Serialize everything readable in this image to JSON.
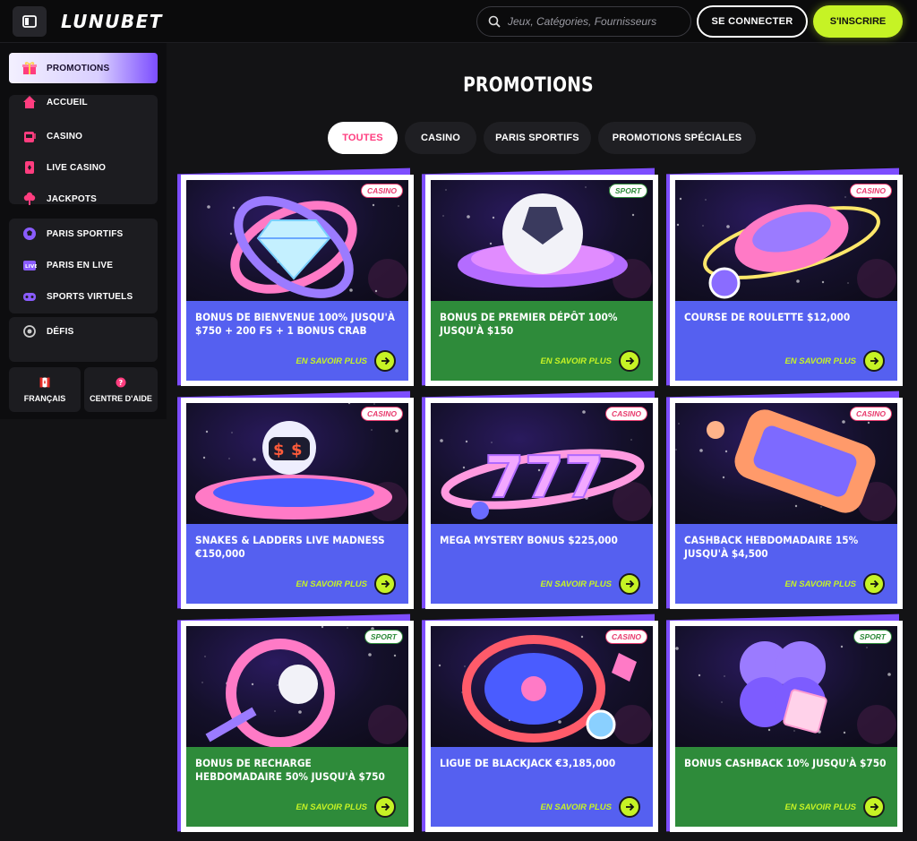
{
  "header": {
    "logo": "LUNUBET",
    "search_placeholder": "Jeux, Catégories, Fournisseurs",
    "login_label": "SE CONNECTER",
    "signup_label": "S'INSCRIRE"
  },
  "sidebar": {
    "promotions": "PROMOTIONS",
    "group1": [
      "ACCUEIL",
      "CASINO",
      "LIVE CASINO",
      "JACKPOTS"
    ],
    "group2": [
      "PARIS SPORTIFS",
      "PARIS EN LIVE",
      "SPORTS VIRTUELS"
    ],
    "group3": [
      "DÉFIS"
    ],
    "language": "FRANÇAIS",
    "help": "CENTRE D'AIDE"
  },
  "main": {
    "title": "PROMOTIONS",
    "tabs": [
      "TOUTES",
      "CASINO",
      "PARIS SPORTIFS",
      "PROMOTIONS SPÉCIALES"
    ],
    "more_label": "EN SAVOIR PLUS",
    "cards": [
      {
        "title": "BONUS DE BIENVENUE 100% JUSQU'À $750 + 200 FS + 1 BONUS CRAB",
        "badge": "CASINO",
        "color": "blue",
        "art": "diamond"
      },
      {
        "title": "BONUS DE PREMIER DÉPÔT 100% JUSQU'À $150",
        "badge": "SPORT",
        "color": "green",
        "art": "football"
      },
      {
        "title": "COURSE DE ROULETTE $12,000",
        "badge": "CASINO",
        "color": "blue",
        "art": "roulette"
      },
      {
        "title": "SNAKES & LADDERS LIVE MADNESS €150,000",
        "badge": "CASINO",
        "color": "blue",
        "art": "robot"
      },
      {
        "title": "MEGA MYSTERY BONUS $225,000",
        "badge": "CASINO",
        "color": "blue",
        "art": "sevens"
      },
      {
        "title": "CASHBACK HEBDOMADAIRE 15% JUSQU'À $4,500",
        "badge": "CASINO",
        "color": "blue",
        "art": "slot"
      },
      {
        "title": "BONUS DE RECHARGE HEBDOMADAIRE 50% JUSQU'À $750",
        "badge": "SPORT",
        "color": "green",
        "art": "tennis"
      },
      {
        "title": "LIGUE DE BLACKJACK €3,185,000",
        "badge": "CASINO",
        "color": "blue",
        "art": "chips"
      },
      {
        "title": "BONUS CASHBACK 10% JUSQU'À $750",
        "badge": "SPORT",
        "color": "green",
        "art": "gift"
      }
    ]
  }
}
